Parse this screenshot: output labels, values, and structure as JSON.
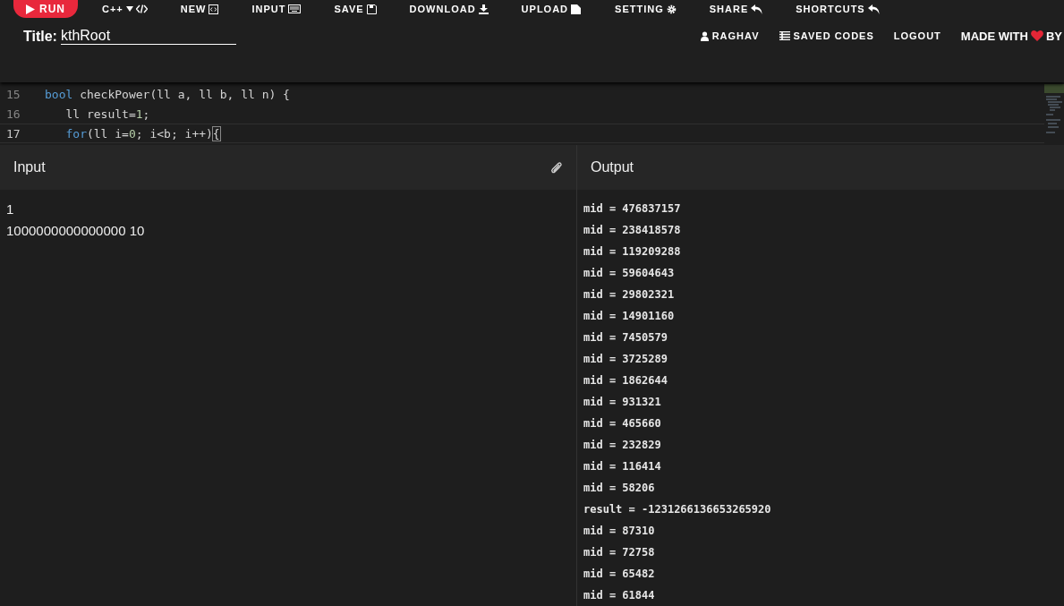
{
  "toolbar": [
    {
      "label": "RUN",
      "kind": "run"
    },
    {
      "label": "C++",
      "kind": "lang"
    },
    {
      "label": "NEW",
      "kind": "new"
    },
    {
      "label": "INPUT",
      "kind": "keyboard"
    },
    {
      "label": "SAVE",
      "kind": "save"
    },
    {
      "label": "DOWNLOAD",
      "kind": "download"
    },
    {
      "label": "UPLOAD",
      "kind": "upload"
    },
    {
      "label": "SETTING",
      "kind": "gear"
    },
    {
      "label": "SHARE",
      "kind": "share"
    },
    {
      "label": "SHORTCUTS",
      "kind": "share"
    }
  ],
  "title": {
    "label": "Title:",
    "value": "kthRoot"
  },
  "user_menu": [
    {
      "label": "RAGHAV",
      "kind": "user"
    },
    {
      "label": "SAVED CODES",
      "kind": "list"
    },
    {
      "label": "LOGOUT",
      "kind": "none"
    }
  ],
  "made_with": {
    "before": "MADE WITH",
    "after": "BY"
  },
  "editor": {
    "lines": [
      {
        "number": "15",
        "current": false,
        "tokens": [
          {
            "text": "bool",
            "kind": "keyword"
          },
          {
            "text": " checkPower(ll a, ll b, ll n) {",
            "kind": "plain"
          }
        ]
      },
      {
        "number": "16",
        "current": false,
        "tokens": [
          {
            "text": "   ll result=",
            "kind": "plain"
          },
          {
            "text": "1",
            "kind": "number"
          },
          {
            "text": ";",
            "kind": "plain"
          }
        ]
      },
      {
        "number": "17",
        "current": true,
        "tokens": [
          {
            "text": "   for",
            "kind": "keyword"
          },
          {
            "text": "(ll i=",
            "kind": "plain"
          },
          {
            "text": "0",
            "kind": "number"
          },
          {
            "text": "; i<b; i++)",
            "kind": "plain"
          },
          {
            "text": "{",
            "kind": "bracket"
          }
        ]
      }
    ]
  },
  "input_panel": {
    "title": "Input",
    "lines": [
      "1",
      "1000000000000000 10"
    ]
  },
  "output_panel": {
    "title": "Output",
    "lines": [
      "mid = 476837157",
      "mid = 238418578",
      "mid = 119209288",
      "mid = 59604643",
      "mid = 29802321",
      "mid = 14901160",
      "mid = 7450579",
      "mid = 3725289",
      "mid = 1862644",
      "mid = 931321",
      "mid = 465660",
      "mid = 232829",
      "mid = 116414",
      "mid = 58206",
      "result = -1231266136653265920",
      "mid = 87310",
      "mid = 72758",
      "mid = 65482",
      "mid = 61844"
    ]
  }
}
